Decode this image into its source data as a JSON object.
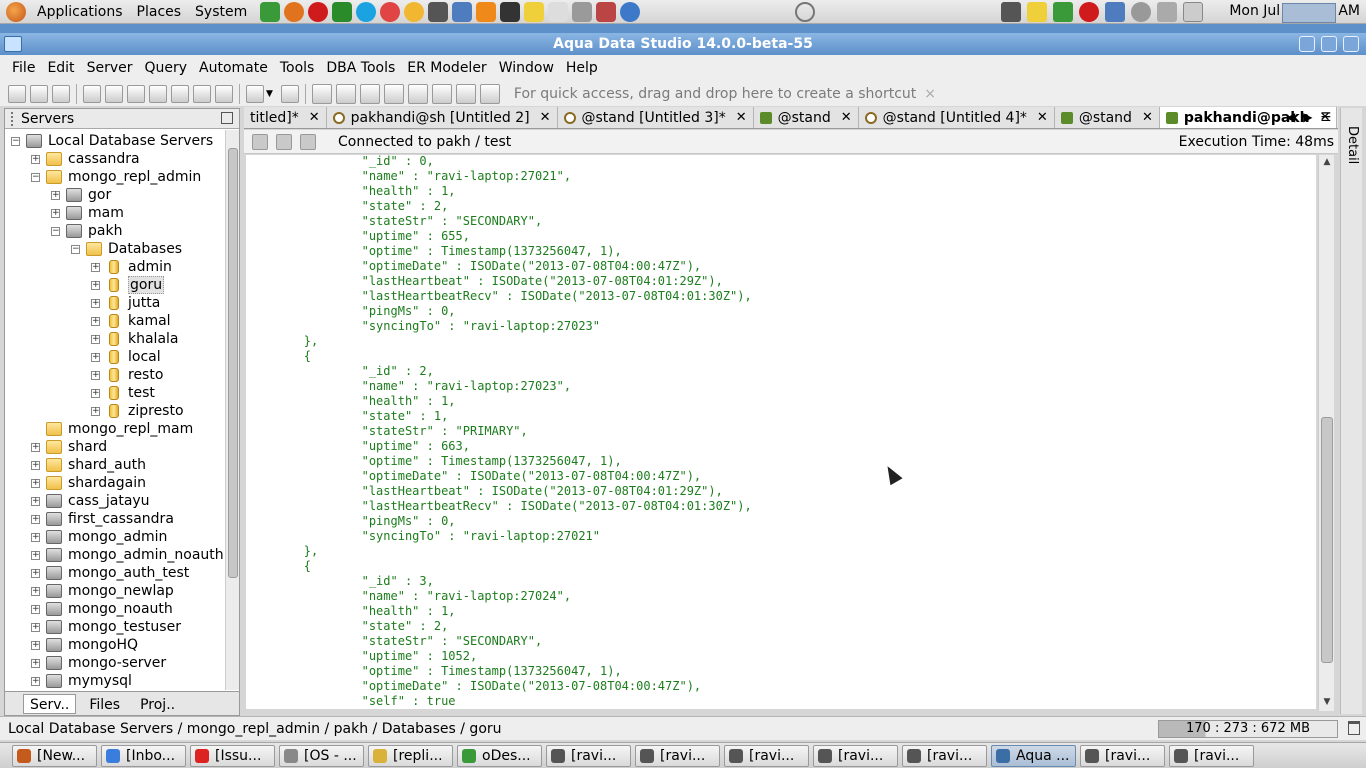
{
  "gnome_panel": {
    "menus": [
      "Applications",
      "Places",
      "System"
    ],
    "clock": "Mon Jul  8,  9:46 AM"
  },
  "window": {
    "title": "Aqua Data Studio 14.0.0-beta-55"
  },
  "menubar": [
    "File",
    "Edit",
    "Server",
    "Query",
    "Automate",
    "Tools",
    "DBA Tools",
    "ER Modeler",
    "Window",
    "Help"
  ],
  "toolbar": {
    "shortcut_hint": "For quick access, drag and drop here to create a shortcut",
    "shortcut_close": "×"
  },
  "servers_panel": {
    "title": "Servers",
    "tree": [
      {
        "label": "Local Database Servers",
        "icon": "server",
        "exp": "−"
      },
      {
        "label": "cassandra",
        "icon": "folder",
        "exp": "+"
      },
      {
        "label": "mongo_repl_admin",
        "icon": "folder",
        "exp": "−"
      },
      {
        "label": "gor",
        "icon": "server",
        "exp": "+"
      },
      {
        "label": "mam",
        "icon": "server",
        "exp": "+"
      },
      {
        "label": "pakh",
        "icon": "server",
        "exp": "−"
      },
      {
        "label": "Databases",
        "icon": "folder",
        "exp": "−"
      },
      {
        "label": "admin",
        "icon": "db",
        "exp": "+"
      },
      {
        "label": "goru",
        "icon": "db",
        "exp": "+"
      },
      {
        "label": "jutta",
        "icon": "db",
        "exp": "+"
      },
      {
        "label": "kamal",
        "icon": "db",
        "exp": "+"
      },
      {
        "label": "khalala",
        "icon": "db",
        "exp": "+"
      },
      {
        "label": "local",
        "icon": "db",
        "exp": "+"
      },
      {
        "label": "resto",
        "icon": "db",
        "exp": "+"
      },
      {
        "label": "test",
        "icon": "db",
        "exp": "+"
      },
      {
        "label": "zipresto",
        "icon": "db",
        "exp": "+"
      },
      {
        "label": "mongo_repl_mam",
        "icon": "folder",
        "exp": ""
      },
      {
        "label": "shard",
        "icon": "folder",
        "exp": "+"
      },
      {
        "label": "shard_auth",
        "icon": "folder",
        "exp": "+"
      },
      {
        "label": "shardagain",
        "icon": "folder",
        "exp": "+"
      },
      {
        "label": "cass_jatayu",
        "icon": "server",
        "exp": "+"
      },
      {
        "label": "first_cassandra",
        "icon": "server",
        "exp": "+"
      },
      {
        "label": "mongo_admin",
        "icon": "server",
        "exp": "+"
      },
      {
        "label": "mongo_admin_noauth",
        "icon": "server",
        "exp": "+"
      },
      {
        "label": "mongo_auth_test",
        "icon": "server",
        "exp": "+"
      },
      {
        "label": "mongo_newlap",
        "icon": "server",
        "exp": "+"
      },
      {
        "label": "mongo_noauth",
        "icon": "server",
        "exp": "+"
      },
      {
        "label": "mongo_testuser",
        "icon": "server",
        "exp": "+"
      },
      {
        "label": "mongoHQ",
        "icon": "server",
        "exp": "+"
      },
      {
        "label": "mongo-server",
        "icon": "server",
        "exp": "+"
      },
      {
        "label": "mymysql",
        "icon": "server",
        "exp": "+"
      }
    ],
    "selected": "goru",
    "bottom_tabs": [
      "Serv..",
      "Files",
      "Proj.."
    ]
  },
  "tabs": [
    {
      "label": "titled]*",
      "icon": "",
      "active": false
    },
    {
      "label": "pakhandi@sh [Untitled 2]",
      "icon": "q",
      "active": false
    },
    {
      "label": "@stand [Untitled 3]*",
      "icon": "q",
      "active": false
    },
    {
      "label": "@stand",
      "icon": "r",
      "active": false
    },
    {
      "label": "@stand [Untitled 4]*",
      "icon": "q",
      "active": false
    },
    {
      "label": "@stand",
      "icon": "r",
      "active": false
    },
    {
      "label": "pakhandi@pakh",
      "icon": "r",
      "active": true
    }
  ],
  "detail_label": "Detail",
  "connection": {
    "text": "Connected to pakh / test",
    "exec_time": "Execution Time: 48ms"
  },
  "results_text": "                \"_id\" : 0,\n                \"name\" : \"ravi-laptop:27021\",\n                \"health\" : 1,\n                \"state\" : 2,\n                \"stateStr\" : \"SECONDARY\",\n                \"uptime\" : 655,\n                \"optime\" : Timestamp(1373256047, 1),\n                \"optimeDate\" : ISODate(\"2013-07-08T04:00:47Z\"),\n                \"lastHeartbeat\" : ISODate(\"2013-07-08T04:01:29Z\"),\n                \"lastHeartbeatRecv\" : ISODate(\"2013-07-08T04:01:30Z\"),\n                \"pingMs\" : 0,\n                \"syncingTo\" : \"ravi-laptop:27023\"\n        },\n        {\n                \"_id\" : 2,\n                \"name\" : \"ravi-laptop:27023\",\n                \"health\" : 1,\n                \"state\" : 1,\n                \"stateStr\" : \"PRIMARY\",\n                \"uptime\" : 663,\n                \"optime\" : Timestamp(1373256047, 1),\n                \"optimeDate\" : ISODate(\"2013-07-08T04:00:47Z\"),\n                \"lastHeartbeat\" : ISODate(\"2013-07-08T04:01:29Z\"),\n                \"lastHeartbeatRecv\" : ISODate(\"2013-07-08T04:01:30Z\"),\n                \"pingMs\" : 0,\n                \"syncingTo\" : \"ravi-laptop:27021\"\n        },\n        {\n                \"_id\" : 3,\n                \"name\" : \"ravi-laptop:27024\",\n                \"health\" : 1,\n                \"state\" : 2,\n                \"stateStr\" : \"SECONDARY\",\n                \"uptime\" : 1052,\n                \"optime\" : Timestamp(1373256047, 1),\n                \"optimeDate\" : ISODate(\"2013-07-08T04:00:47Z\"),\n                \"self\" : true",
  "statusbar": {
    "path": "Local Database Servers / mongo_repl_admin / pakh / Databases / goru",
    "memory": "170 : 273 : 672 MB"
  },
  "taskbar": [
    {
      "label": "[New...",
      "icon": "#c45a1c",
      "active": false
    },
    {
      "label": "[Inbo...",
      "icon": "#3b7ddd",
      "active": false
    },
    {
      "label": "[Issu...",
      "icon": "#d22",
      "active": false
    },
    {
      "label": "[OS - ...",
      "icon": "#888",
      "active": false
    },
    {
      "label": "[repli...",
      "icon": "#d8b23a",
      "active": false
    },
    {
      "label": "oDes...",
      "icon": "#3a9a3a",
      "active": false
    },
    {
      "label": "[ravi...",
      "icon": "#555",
      "active": false
    },
    {
      "label": "[ravi...",
      "icon": "#555",
      "active": false
    },
    {
      "label": "[ravi...",
      "icon": "#555",
      "active": false
    },
    {
      "label": "[ravi...",
      "icon": "#555",
      "active": false
    },
    {
      "label": "[ravi...",
      "icon": "#555",
      "active": false
    },
    {
      "label": "Aqua ...",
      "icon": "#3b6ea5",
      "active": true
    },
    {
      "label": "[ravi...",
      "icon": "#555",
      "active": false
    },
    {
      "label": "[ravi...",
      "icon": "#555",
      "active": false
    }
  ],
  "colors": {
    "accent": "#5d8fc9",
    "result_text": "#1d7d1d"
  }
}
